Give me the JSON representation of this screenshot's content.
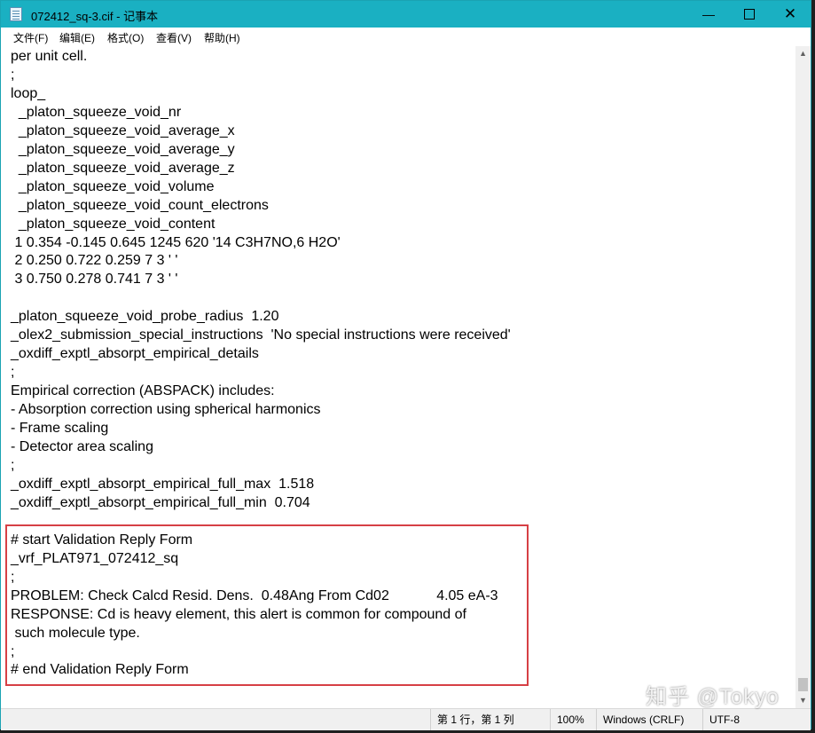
{
  "window": {
    "title": "072412_sq-3.cif - 记事本",
    "accent_color": "#1ab0c2",
    "controls": {
      "minimize_icon": "minimize-icon",
      "maximize_icon": "maximize-icon",
      "close_icon": "close-icon"
    }
  },
  "menu": [
    {
      "label": "文件(F)"
    },
    {
      "label": "编辑(E)"
    },
    {
      "label": "格式(O)"
    },
    {
      "label": "查看(V)"
    },
    {
      "label": "帮助(H)"
    }
  ],
  "editor": {
    "content": "per unit cell.\n;\nloop_\n  _platon_squeeze_void_nr\n  _platon_squeeze_void_average_x\n  _platon_squeeze_void_average_y\n  _platon_squeeze_void_average_z\n  _platon_squeeze_void_volume\n  _platon_squeeze_void_count_electrons\n  _platon_squeeze_void_content\n 1 0.354 -0.145 0.645 1245 620 '14 C3H7NO,6 H2O'\n 2 0.250 0.722 0.259 7 3 ' '\n 3 0.750 0.278 0.741 7 3 ' '\n\n_platon_squeeze_void_probe_radius  1.20\n_olex2_submission_special_instructions  'No special instructions were received'\n_oxdiff_exptl_absorpt_empirical_details\n;\nEmpirical correction (ABSPACK) includes:\n- Absorption correction using spherical harmonics\n- Frame scaling\n- Detector area scaling\n;\n_oxdiff_exptl_absorpt_empirical_full_max  1.518\n_oxdiff_exptl_absorpt_empirical_full_min  0.704\n\n# start Validation Reply Form\n_vrf_PLAT971_072412_sq\n;\nPROBLEM: Check Calcd Resid. Dens.  0.48Ang From Cd02            4.05 eA-3\nRESPONSE: Cd is heavy element, this alert is common for compound of\n such molecule type.\n;\n# end Validation Reply Form",
    "highlight_color": "#d64045"
  },
  "status": {
    "position": "第 1 行，第 1 列",
    "zoom": "100%",
    "line_ending": "Windows (CRLF)",
    "encoding": "UTF-8"
  },
  "watermark": "知乎 @Tokyo"
}
